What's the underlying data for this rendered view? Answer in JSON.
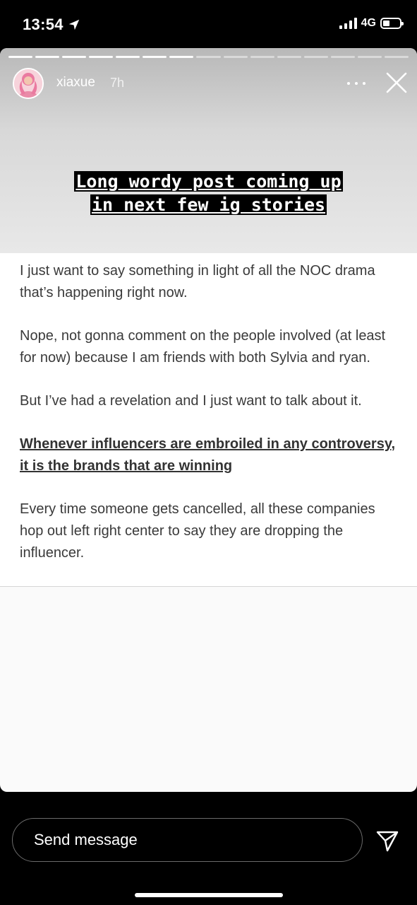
{
  "status_bar": {
    "time": "13:54",
    "network": "4G",
    "icons": [
      "location-arrow-icon",
      "signal-icon",
      "battery-icon"
    ]
  },
  "story": {
    "username": "xiaxue",
    "time_ago": "7h",
    "progress": {
      "segments": 15,
      "completed": 7
    },
    "headline_lines": [
      "Long wordy post coming up",
      "in next few ig stories"
    ],
    "paragraphs": [
      "I just want to say something in light of all the NOC drama that’s happening right now.",
      "Nope, not gonna comment on the people involved (at least for now) because I am friends with both Sylvia and ryan.",
      "But I’ve had a revelation and I just want to talk about it.",
      "Whenever influencers are embroiled in any controversy, it is the brands that are winning",
      "Every time someone gets cancelled, all these companies hop out left right center to say they are dropping the influencer."
    ]
  },
  "composer": {
    "placeholder": "Send message"
  },
  "colors": {
    "background": "#000000",
    "card": "#fafafa",
    "text": "#3a3a3a"
  }
}
